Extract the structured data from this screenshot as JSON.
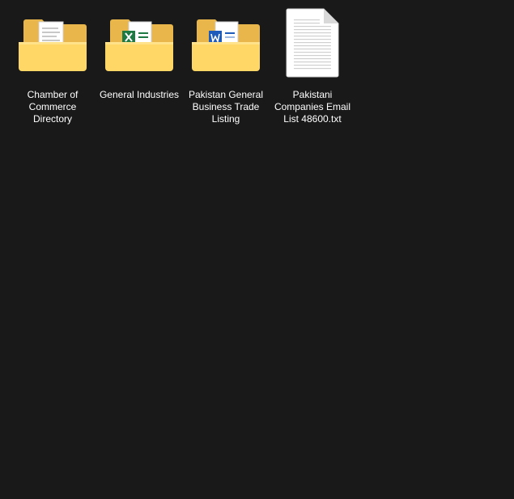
{
  "desktop": {
    "items": [
      {
        "label": "Chamber of Commerce Directory",
        "type": "folder",
        "icon": "folder-with-document-icon"
      },
      {
        "label": "General Industries",
        "type": "folder",
        "icon": "folder-with-excel-icon"
      },
      {
        "label": "Pakistan General Business Trade Listing",
        "type": "folder",
        "icon": "folder-with-word-icon"
      },
      {
        "label": "Pakistani Companies Email List 48600.txt",
        "type": "file",
        "icon": "text-file-icon"
      }
    ]
  },
  "colors": {
    "background": "#191919",
    "folder_back": "#e8b64a",
    "folder_front": "#ffd766",
    "excel_green": "#1d7a43",
    "word_blue": "#1f5bb8",
    "label_text": "#ffffff"
  }
}
